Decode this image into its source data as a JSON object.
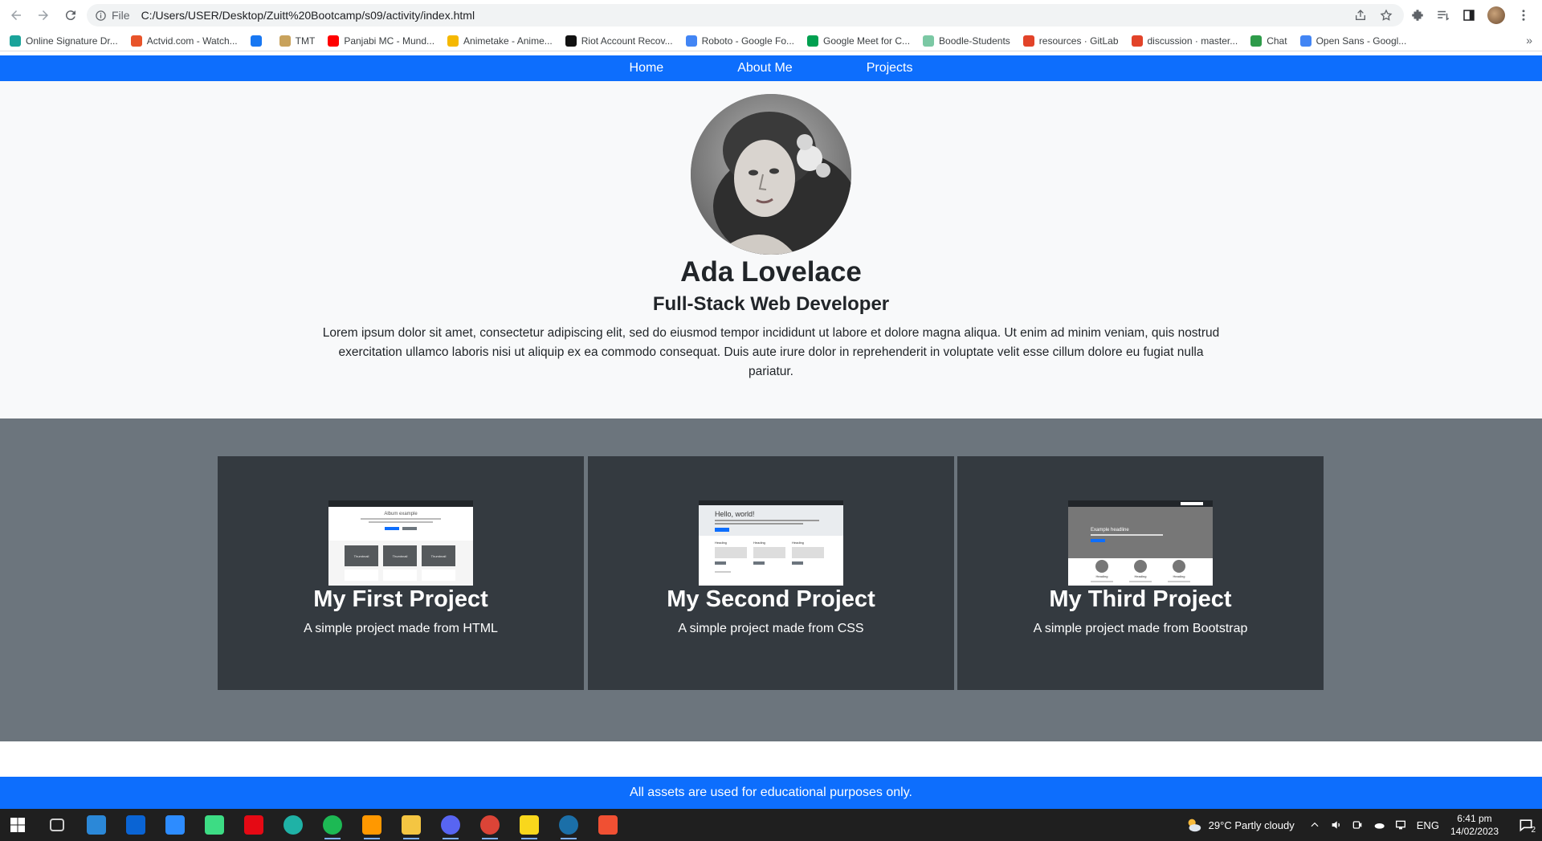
{
  "browser": {
    "file_label": "File",
    "url": "C:/Users/USER/Desktop/Zuitt%20Bootcamp/s09/activity/index.html",
    "bookmarks": [
      {
        "label": "Online Signature Dr...",
        "color": "#1aa39a"
      },
      {
        "label": "Actvid.com - Watch...",
        "color": "#e8542a"
      },
      {
        "label": "",
        "color": "#1877f2"
      },
      {
        "label": "TMT",
        "color": "#c8a25c"
      },
      {
        "label": "Panjabi MC - Mund...",
        "color": "#ff0000"
      },
      {
        "label": "Animetake - Anime...",
        "color": "#f5b800"
      },
      {
        "label": "Riot Account Recov...",
        "color": "#111111"
      },
      {
        "label": "Roboto - Google Fo...",
        "color": "#4285f4"
      },
      {
        "label": "Google Meet for C...",
        "color": "#00a050"
      },
      {
        "label": "Boodle-Students",
        "color": "#7bc8a4"
      },
      {
        "label": "resources · GitLab",
        "color": "#e24329"
      },
      {
        "label": "discussion · master...",
        "color": "#e24329"
      },
      {
        "label": "Chat",
        "color": "#2e9b4a"
      },
      {
        "label": "Open Sans - Googl...",
        "color": "#4285f4"
      }
    ],
    "more_glyph": "»"
  },
  "navbar": {
    "links": [
      "Home",
      "About Me",
      "Projects"
    ],
    "bg_color": "#0d6efd"
  },
  "hero": {
    "name": "Ada Lovelace",
    "role": "Full-Stack Web Developer",
    "description": "Lorem ipsum dolor sit amet, consectetur adipiscing elit, sed do eiusmod tempor incididunt ut labore et dolore magna aliqua. Ut enim ad minim veniam, quis nostrud exercitation ullamco laboris nisi ut aliquip ex ea commodo consequat. Duis aute irure dolor in reprehenderit in voluptate velit esse cillum dolore eu fugiat nulla pariatur."
  },
  "projects": [
    {
      "title": "My First Project",
      "text": "A simple project made from HTML"
    },
    {
      "title": "My Second Project",
      "text": "A simple project made from CSS"
    },
    {
      "title": "My Third Project",
      "text": "A simple project made from Bootstrap"
    }
  ],
  "thumbs": {
    "first_heading": "Album example",
    "first_cards": [
      "Thumbnail",
      "Thumbnail",
      "Thumbnail"
    ],
    "second_heading": "Hello, world!",
    "second_cols": [
      "Heading",
      "Heading",
      "Heading"
    ],
    "third_heading": "Example headline",
    "third_cols": [
      "Heading",
      "Heading",
      "Heading"
    ]
  },
  "footer": {
    "text": "All assets are used for educational purposes only."
  },
  "taskbar": {
    "apps": [
      {
        "name": "start",
        "color": "#ffffff"
      },
      {
        "name": "task-view",
        "color": "#cfcfcf"
      },
      {
        "name": "store",
        "color": "#2b88d8"
      },
      {
        "name": "mail",
        "color": "#0a64d4"
      },
      {
        "name": "zoom",
        "color": "#2d8cff"
      },
      {
        "name": "android-studio",
        "color": "#3ddc84"
      },
      {
        "name": "netflix",
        "color": "#e50914"
      },
      {
        "name": "edge",
        "color": "#1fb2a6"
      },
      {
        "name": "spotify",
        "color": "#1db954"
      },
      {
        "name": "sublime",
        "color": "#ff9800"
      },
      {
        "name": "file-explorer",
        "color": "#f4c542"
      },
      {
        "name": "discord",
        "color": "#5865f2"
      },
      {
        "name": "chrome",
        "color": "#db4437"
      },
      {
        "name": "sticky-notes",
        "color": "#f9d71c"
      },
      {
        "name": "steam",
        "color": "#1b6fa8"
      },
      {
        "name": "git",
        "color": "#f05033"
      }
    ],
    "weather": "29°C  Partly cloudy",
    "language": "ENG",
    "time": "6:41 pm",
    "date": "14/02/2023",
    "notifications": "2"
  }
}
